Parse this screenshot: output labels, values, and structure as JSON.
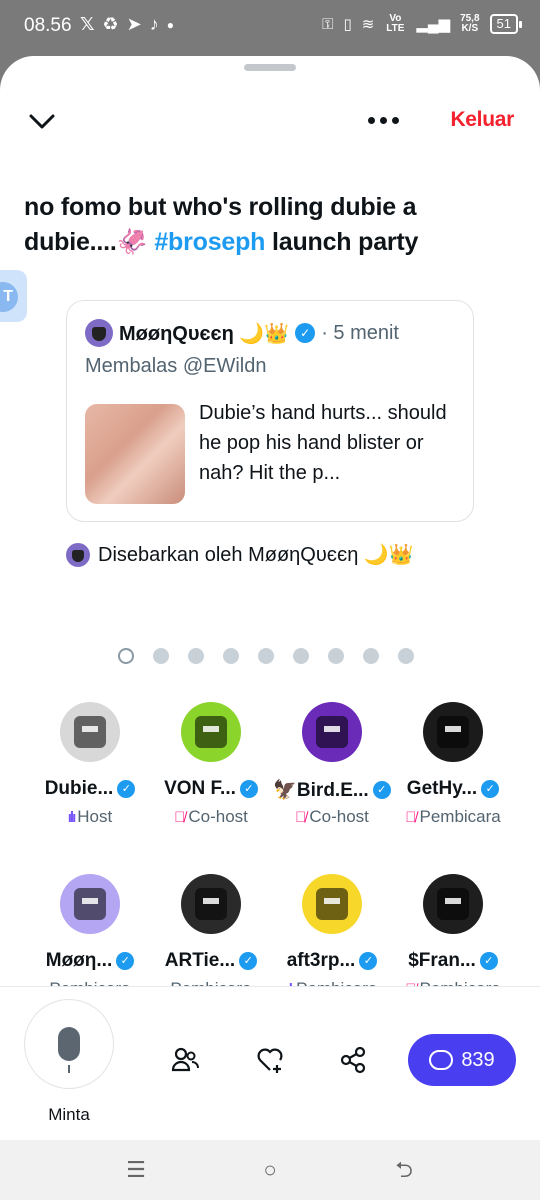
{
  "status": {
    "time": "08.56",
    "network_label": "Vo LTE",
    "speed_value": "75,8",
    "speed_unit": "K/S",
    "battery": "51",
    "left_icons": [
      "x-logo-icon",
      "recycle-icon",
      "telegram-icon",
      "tiktok-icon",
      "dot-icon"
    ],
    "right_icons": [
      "key-icon",
      "vibrate-icon",
      "wifi-icon",
      "signal-icon"
    ]
  },
  "header": {
    "leave_label": "Keluar",
    "leave_color": "#f4212e"
  },
  "space": {
    "title_prefix": "no fomo but who's rolling dubie a dubie....🦑 ",
    "title_hashtag": "#broseph",
    "title_suffix": " launch party"
  },
  "pinned": {
    "author": "ΜøøηQυєєη 🌙👑",
    "time": "· 5 menit",
    "reply_to": "Membalas @EWildn",
    "text": "Dubie’s hand hurts... should he pop his hand blister or nah? Hit the p...",
    "spread_by": "Disebarkan oleh ΜøøηQυєєη 🌙👑"
  },
  "pager": {
    "count": 9,
    "active_index": 0
  },
  "participants": [
    {
      "name": "Dubie...",
      "role": "Host",
      "role_icon": "host",
      "avatar_color": "#d8d8d8"
    },
    {
      "name": "VON F...",
      "role": "Co-host",
      "role_icon": "muted",
      "avatar_color": "#8bd42c"
    },
    {
      "name": "🦅Bird.E...",
      "role": "Co-host",
      "role_icon": "muted",
      "avatar_color": "#6a2bb8"
    },
    {
      "name": "GetHy...",
      "role": "Pembicara",
      "role_icon": "muted",
      "avatar_color": "#1b1b1b"
    },
    {
      "name": "Μøøη...",
      "role": "Pembicara",
      "role_icon": "none",
      "avatar_color": "#b4a6f2"
    },
    {
      "name": "ARTie...",
      "role": "Pembicara",
      "role_icon": "none",
      "avatar_color": "#2a2a2a"
    },
    {
      "name": "aft3rp...",
      "role": "Pembicara",
      "role_icon": "host",
      "avatar_color": "#f7d72a"
    },
    {
      "name": "$Fran...",
      "role": "Pembicara",
      "role_icon": "muted",
      "avatar_color": "#1e1e1e"
    }
  ],
  "bottom": {
    "mic_label": "Minta",
    "chat_count": "839",
    "chat_color": "#4a3ff0"
  }
}
